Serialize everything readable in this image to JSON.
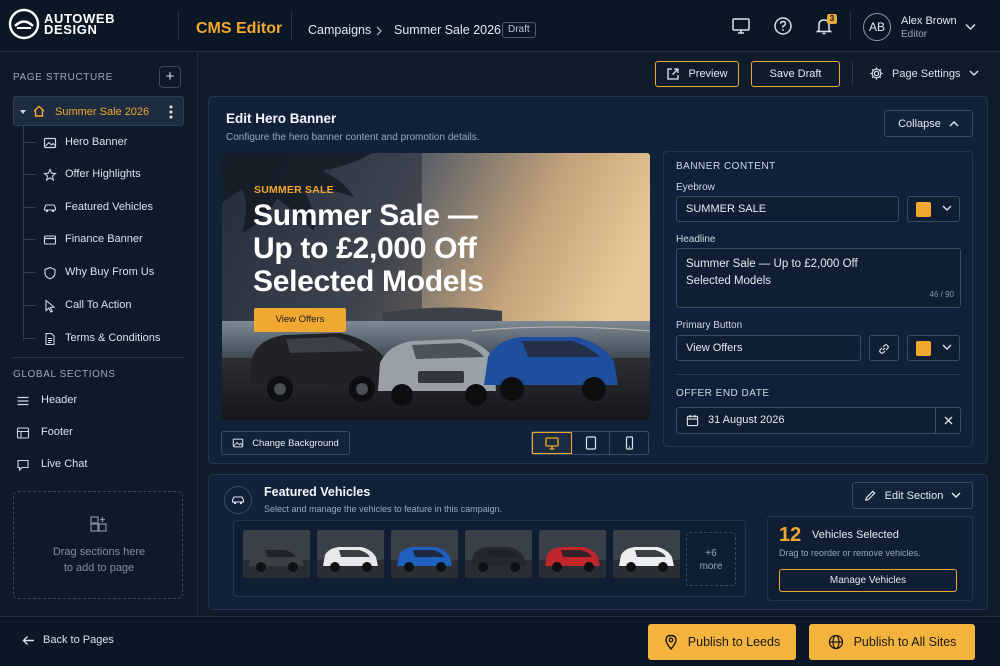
{
  "brand": {
    "logo_line1": "AUTOWEB",
    "logo_line2": "DESIGN",
    "app_title": "CMS Editor"
  },
  "breadcrumb": {
    "section": "Campaigns",
    "page": "Summer Sale 2026",
    "status": "Draft"
  },
  "header": {
    "notification_count": "3",
    "avatar_initials": "AB",
    "user_name": "Alex Brown",
    "user_role": "Editor"
  },
  "sidebar": {
    "page_structure_label": "PAGE STRUCTURE",
    "root": "Summer Sale 2026",
    "items": [
      {
        "label": "Hero Banner",
        "icon": "image-icon"
      },
      {
        "label": "Offer Highlights",
        "icon": "star-icon"
      },
      {
        "label": "Featured Vehicles",
        "icon": "car-icon"
      },
      {
        "label": "Finance Banner",
        "icon": "card-icon"
      },
      {
        "label": "Why Buy From Us",
        "icon": "shield-icon"
      },
      {
        "label": "Call To Action",
        "icon": "cursor-icon"
      },
      {
        "label": "Terms & Conditions",
        "icon": "document-icon"
      }
    ],
    "global_label": "GLOBAL SECTIONS",
    "global_items": [
      {
        "label": "Header",
        "icon": "menu-icon"
      },
      {
        "label": "Footer",
        "icon": "layout-icon"
      },
      {
        "label": "Live Chat",
        "icon": "chat-icon"
      }
    ],
    "dropzone_line1": "Drag sections here",
    "dropzone_line2": "to add to page"
  },
  "toolbar": {
    "preview": "Preview",
    "save_draft": "Save Draft",
    "page_settings": "Page Settings"
  },
  "hero_editor": {
    "title": "Edit Hero Banner",
    "subtitle": "Configure the hero banner content and promotion details.",
    "collapse": "Collapse",
    "change_background": "Change Background",
    "preview": {
      "eyebrow": "SUMMER SALE",
      "headline_1": "Summer Sale —",
      "headline_2": "Up to £2,000 Off",
      "headline_3": "Selected Models",
      "button": "View Offers"
    },
    "form": {
      "section_label": "BANNER CONTENT",
      "eyebrow_label": "Eyebrow",
      "eyebrow_value": "SUMMER SALE",
      "eyebrow_color": "#f0a830",
      "headline_label": "Headline",
      "headline_line1": "Summer Sale — Up to £2,000 Off",
      "headline_line2": "Selected Models",
      "headline_counter": "46 / 90",
      "button_label": "Primary Button",
      "button_value": "View Offers",
      "button_color": "#f0a830",
      "end_date_label": "OFFER END DATE",
      "end_date_value": "31 August 2026"
    }
  },
  "featured": {
    "title": "Featured Vehicles",
    "subtitle": "Select and manage the vehicles to feature in this campaign.",
    "edit_section": "Edit Section",
    "more_count": "+6",
    "more_label": "more",
    "thumb_colors": [
      "#3b3f46",
      "#e6e8ea",
      "#1f5fbf",
      "#23272e",
      "#c2262d",
      "#eceef0"
    ],
    "selected_count": "12",
    "selected_label": "Vehicles Selected",
    "selected_hint": "Drag to reorder or remove vehicles.",
    "manage": "Manage Vehicles"
  },
  "footer": {
    "back": "Back to Pages",
    "publish_leeds": "Publish to Leeds",
    "publish_all": "Publish to All Sites"
  }
}
